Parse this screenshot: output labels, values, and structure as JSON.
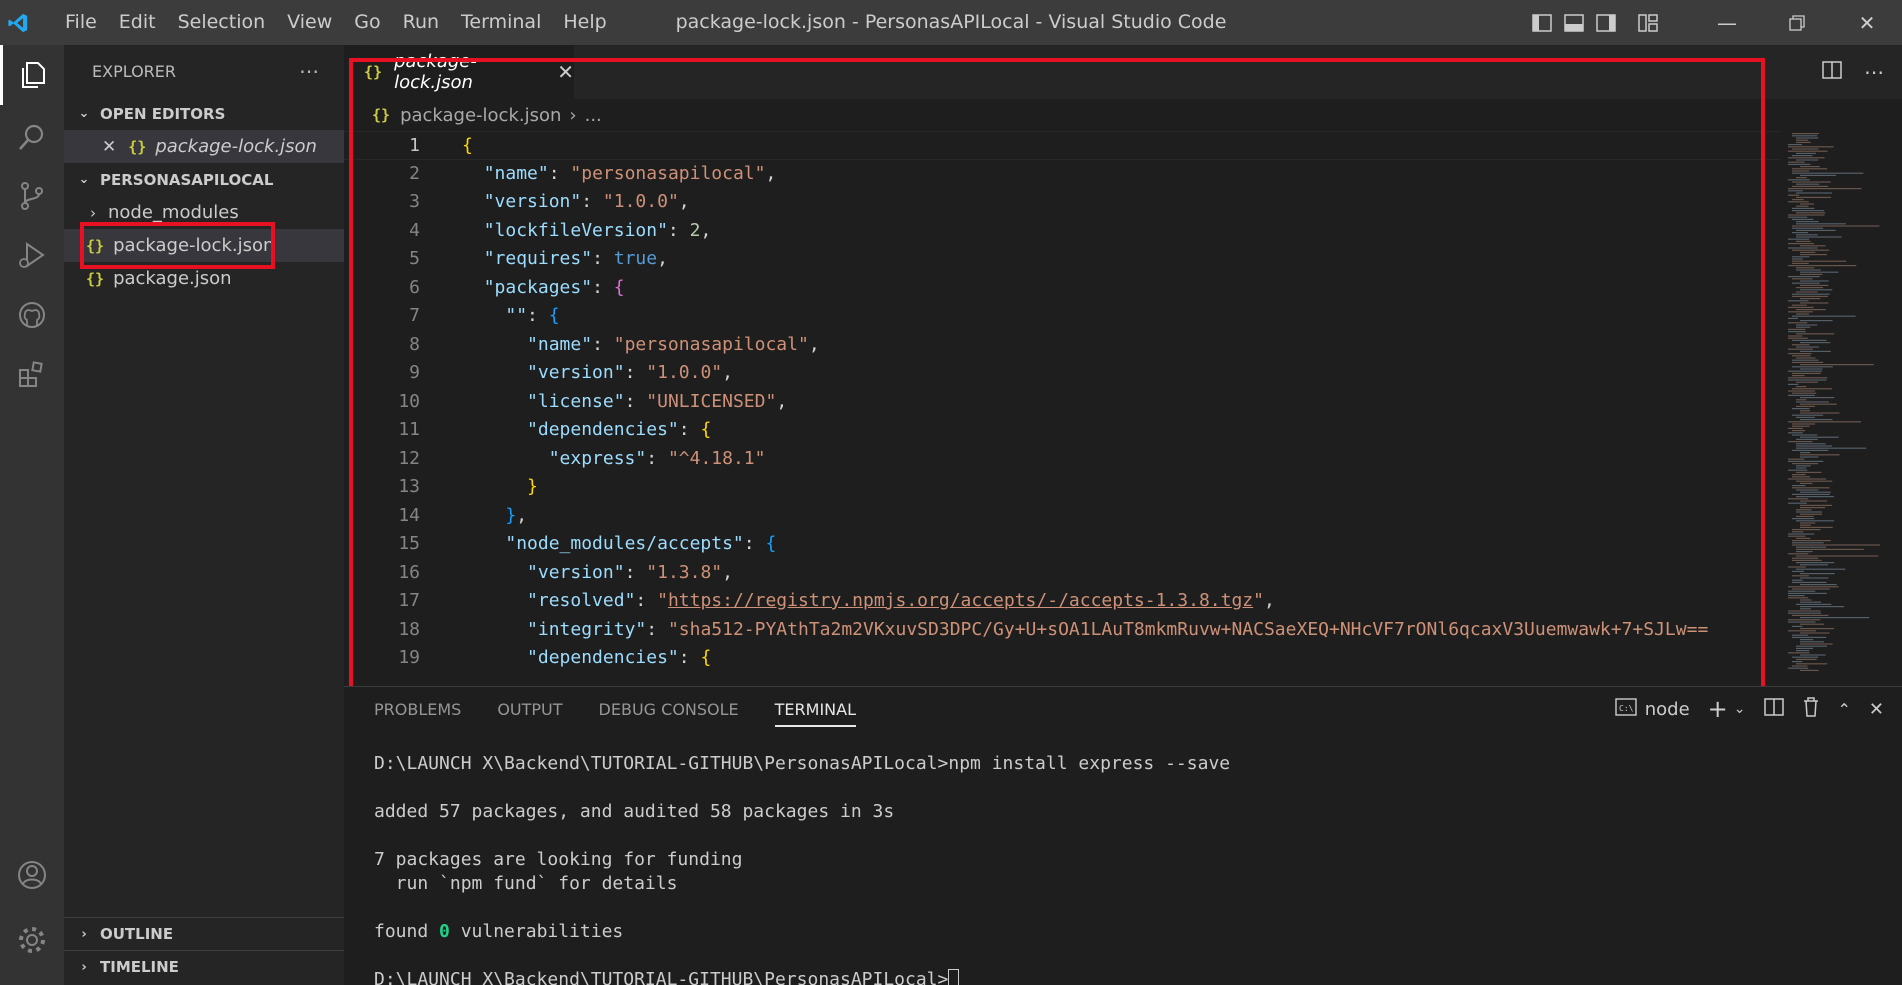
{
  "window": {
    "title": "package-lock.json - PersonasAPILocal - Visual Studio Code",
    "menu": [
      "File",
      "Edit",
      "Selection",
      "View",
      "Go",
      "Run",
      "Terminal",
      "Help"
    ]
  },
  "sidebar": {
    "header": "EXPLORER",
    "open_editors_label": "OPEN EDITORS",
    "open_editor_file": "package-lock.json",
    "project_label": "PERSONASAPILOCAL",
    "files": [
      "node_modules",
      "package-lock.json",
      "package.json"
    ],
    "outline_label": "OUTLINE",
    "timeline_label": "TIMELINE"
  },
  "editor": {
    "tab_label": "package-lock.json",
    "breadcrumb_file": "package-lock.json",
    "breadcrumb_rest": "...",
    "icon_text": "{}",
    "line_numbers": [
      "1",
      "2",
      "3",
      "4",
      "5",
      "6",
      "7",
      "8",
      "9",
      "10",
      "11",
      "12",
      "13",
      "14",
      "15",
      "16",
      "17",
      "18",
      "19"
    ],
    "code": {
      "name_val": "\"personasapilocal\"",
      "version_val": "\"1.0.0\"",
      "lockfile_val": "2",
      "requires_val": "true",
      "license_val": "\"UNLICENSED\"",
      "express_val": "\"^4.18.1\"",
      "accepts_key": "\"node_modules/accepts\"",
      "accepts_version": "\"1.3.8\"",
      "resolved_url": "https://registry.npmjs.org/accepts/-/accepts-1.3.8.tgz",
      "integrity_val": "\"sha512-PYAthTa2m2VKxuvSD3DPC/Gy+U+sOA1LAuT8mkmRuvw+NACSaeXEQ+NHcVF7rONl6qcaxV3Uuemwawk+7+SJLw=="
    }
  },
  "panel": {
    "tabs": [
      "PROBLEMS",
      "OUTPUT",
      "DEBUG CONSOLE",
      "TERMINAL"
    ],
    "active_tab": "TERMINAL",
    "terminal_name": "node",
    "lines": {
      "cmd": "D:\\LAUNCH X\\Backend\\TUTORIAL-GITHUB\\PersonasAPILocal>npm install express --save",
      "added": "added 57 packages, and audited 58 packages in 3s",
      "funding": "7 packages are looking for funding",
      "fund_hint": "  run `npm fund` for details",
      "found_prefix": "found ",
      "found_count": "0",
      "found_suffix": " vulnerabilities",
      "prompt": "D:\\LAUNCH X\\Backend\\TUTORIAL-GITHUB\\PersonasAPILocal>"
    }
  },
  "colors": {
    "accent_blue": "#007acc",
    "highlight_red": "#e81123",
    "json_icon": "#cbcb41"
  }
}
